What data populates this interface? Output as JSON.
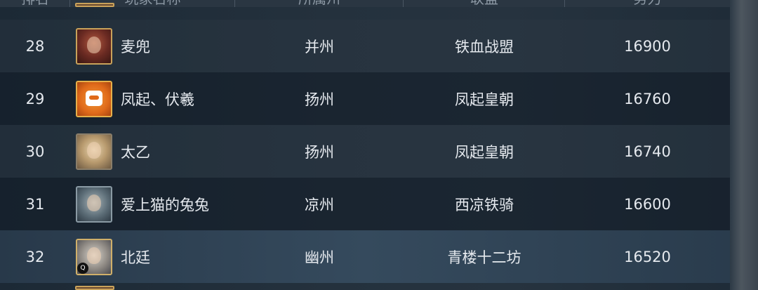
{
  "header": {
    "rank": "排名",
    "name": "玩家名称",
    "state": "所属州",
    "alliance": "联盟",
    "power": "势力"
  },
  "rows": [
    {
      "rank": "28",
      "name": "麦兜",
      "state": "并州",
      "alliance": "铁血战盟",
      "power": "16900",
      "avatar": "red-armored-general-avatar"
    },
    {
      "rank": "29",
      "name": "凤起、伏羲",
      "state": "扬州",
      "alliance": "凤起皇朝",
      "power": "16760",
      "avatar": "orange-robot-avatar"
    },
    {
      "rank": "30",
      "name": "太乙",
      "state": "扬州",
      "alliance": "凤起皇朝",
      "power": "16740",
      "avatar": "blond-warrior-avatar"
    },
    {
      "rank": "31",
      "name": "爱上猫的兔兔",
      "state": "凉州",
      "alliance": "西凉铁骑",
      "power": "16600",
      "avatar": "steel-helmet-avatar"
    },
    {
      "rank": "32",
      "name": "北廷",
      "state": "幽州",
      "alliance": "青楼十二坊",
      "power": "16520",
      "avatar": "silver-hair-avatar",
      "badge": "qq-icon",
      "highlighted": true
    }
  ],
  "colors": {
    "background": "#1d2a36",
    "text": "#e5e9ee",
    "header_text": "#8c98a4",
    "avatar_frame": "#c9a25a",
    "highlight_row": "#354a5d"
  }
}
